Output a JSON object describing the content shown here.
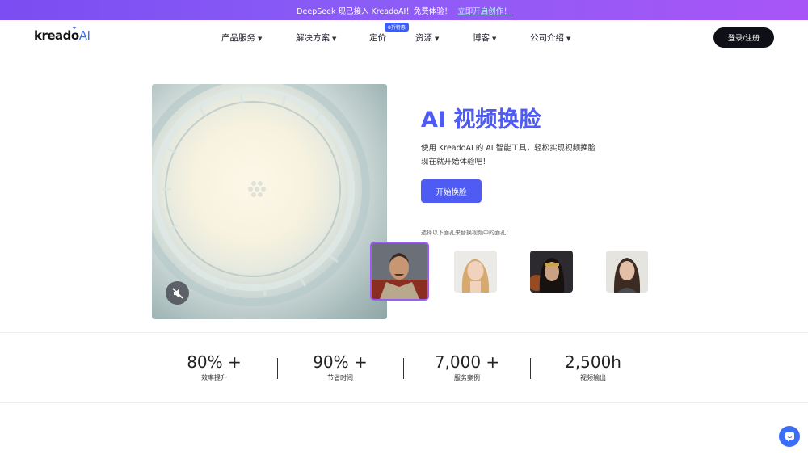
{
  "banner": {
    "text": "DeepSeek 现已接入 KreadoAI！免费体验！",
    "link": "立即开启创作！"
  },
  "logo": {
    "text": "kreado",
    "accent": "AI"
  },
  "nav": {
    "items": [
      {
        "label": "产品服务"
      },
      {
        "label": "解决方案"
      },
      {
        "label": "定价"
      },
      {
        "label": "资源"
      },
      {
        "label": "博客"
      },
      {
        "label": "公司介绍"
      }
    ],
    "pricing_badge": "8折特惠",
    "login_label": "登录/注册"
  },
  "hero": {
    "title": "AI 视频换脸",
    "desc_line1": "使用 KreadoAI 的 AI 智能工具，轻松实现视频换脸",
    "desc_line2": "现在就开始体验吧！",
    "cta_label": "开始换脸",
    "faces_hint": "选择以下面孔来替换视频中的面孔："
  },
  "faces": [
    {
      "name": "face-option-1",
      "selected": true
    },
    {
      "name": "face-option-2",
      "selected": false
    },
    {
      "name": "face-option-3",
      "selected": false
    },
    {
      "name": "face-option-4",
      "selected": false
    }
  ],
  "stats": [
    {
      "value": "80% +",
      "label": "效率提升"
    },
    {
      "value": "90% +",
      "label": "节省时间"
    },
    {
      "value": "7,000 +",
      "label": "服务案例"
    },
    {
      "value": "2,500h",
      "label": "视频输出"
    }
  ],
  "colors": {
    "accent": "#4f5cf3",
    "banner": "#8b5cf6",
    "dark_button": "#0f0f18"
  },
  "icons": {
    "mute": "speaker-muted-icon",
    "chat": "chat-icon",
    "chevron": "chevron-down-icon"
  }
}
